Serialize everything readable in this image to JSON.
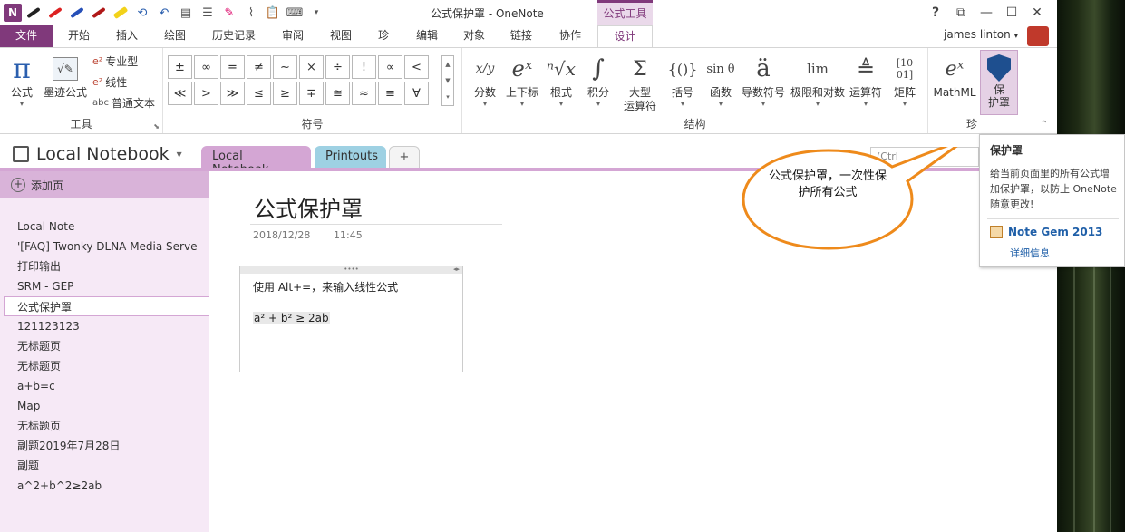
{
  "window": {
    "title": "公式保护罩 - OneNote",
    "context_tab_title": "公式工具",
    "logo": "N",
    "controls": {
      "help": "?",
      "restore_ribbon": "⧉",
      "minimize": "—",
      "maximize": "☐",
      "close": "✕"
    }
  },
  "tabs": [
    "文件",
    "开始",
    "插入",
    "绘图",
    "历史记录",
    "审阅",
    "视图",
    "珍",
    "编辑",
    "对象",
    "链接",
    "协作",
    "设计"
  ],
  "active_tab": "设计",
  "user": {
    "name": "james linton",
    "caret": "▾"
  },
  "ribbon": {
    "tools_group": {
      "label": "工具",
      "formula": "公式",
      "ink_formula": "墨迹公式",
      "professional": "专业型",
      "linear": "线性",
      "normal_text": "普通文本",
      "normal_text_prefix": "abc"
    },
    "symbols_group": {
      "label": "符号",
      "row1": [
        "±",
        "∞",
        "=",
        "≠",
        "~",
        "×",
        "÷",
        "!",
        "∝",
        "<"
      ],
      "row2": [
        "≪",
        ">",
        "≫",
        "≤",
        "≥",
        "∓",
        "≅",
        "≈",
        "≡",
        "∀"
      ]
    },
    "structures_group": {
      "label": "结构",
      "items": [
        {
          "label": "分数",
          "glyph": "x/y"
        },
        {
          "label": "上下标",
          "glyph": "eˣ"
        },
        {
          "label": "根式",
          "glyph": "ⁿ√x"
        },
        {
          "label": "积分",
          "glyph": "∫"
        },
        {
          "label": "大型\n运算符",
          "glyph": "Σ"
        },
        {
          "label": "括号",
          "glyph": "{()}"
        },
        {
          "label": "函数",
          "glyph": "sin θ"
        },
        {
          "label": "导数符号",
          "glyph": "ä"
        },
        {
          "label": "极限和对数",
          "glyph": "lim"
        },
        {
          "label": "运算符",
          "glyph": "≜"
        },
        {
          "label": "矩阵",
          "glyph": "[10 01]"
        }
      ]
    },
    "gem_group": {
      "label": "珍",
      "mathml": "MathML",
      "protect": "保\n护罩"
    },
    "collapse_glyph": "⌃"
  },
  "notebook": {
    "name": "Local Notebook",
    "sections": [
      "Local Notebook",
      "Printouts"
    ],
    "add_section": "+",
    "search_hint": "(Ctrl",
    "dropdown": "▾"
  },
  "pages": {
    "add_label": "添加页",
    "items": [
      "Local Note",
      "'[FAQ] Twonky DLNA Media Serve",
      "打印输出",
      "SRM - GEP",
      "公式保护罩",
      "121123123",
      "无标题页",
      "无标题页",
      "a+b=c",
      "Map",
      "无标题页",
      "副题2019年7月28日",
      "副题",
      "a^2+b^2≥2ab"
    ],
    "selected_index": 4
  },
  "page": {
    "title": "公式保护罩",
    "date": "2018/12/28",
    "time": "11:45",
    "note_line1": "使用 Alt+=，来输入线性公式",
    "note_line2": "a² + b² ≥ 2ab",
    "note_handle": "••••",
    "note_arrows": "◂▸"
  },
  "callout": {
    "text": "公式保护罩，一次性保护所有公式",
    "color": "#ee8a1b"
  },
  "tooltip": {
    "title": "保护罩",
    "body": "给当前页面里的所有公式增加保护罩，以防止 OneNote 随意更改!",
    "gem": "Note Gem 2013",
    "more": "详细信息"
  },
  "colors": {
    "accent": "#80397b",
    "section_a": "#d4a6d4",
    "section_b": "#9ed1e3"
  }
}
